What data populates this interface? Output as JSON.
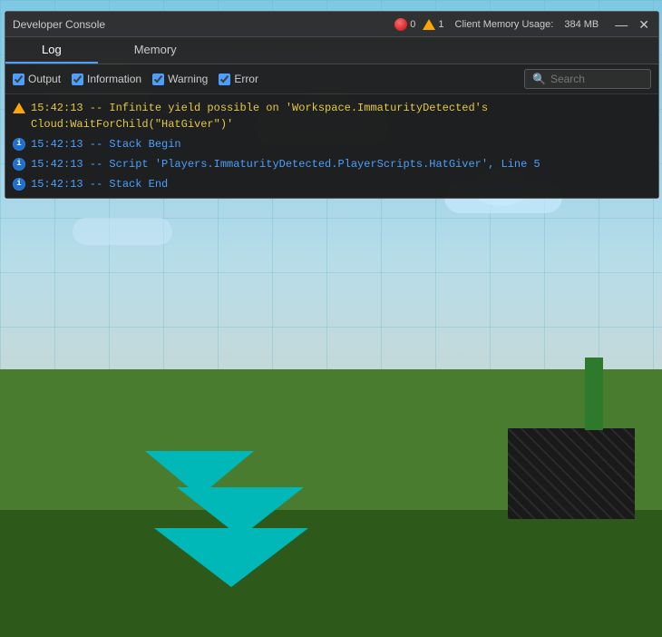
{
  "titleBar": {
    "title": "Developer Console",
    "errorCount": "0",
    "warningCount": "1",
    "memoryLabel": "Client Memory Usage:",
    "memoryValue": "384 MB",
    "minimizeBtn": "—",
    "closeBtn": "✕"
  },
  "tabs": [
    {
      "id": "log",
      "label": "Log",
      "active": true
    },
    {
      "id": "memory",
      "label": "Memory",
      "active": false
    }
  ],
  "filterBar": {
    "output": {
      "label": "Output",
      "checked": true
    },
    "information": {
      "label": "Information",
      "checked": true
    },
    "warning": {
      "label": "Warning",
      "checked": true
    },
    "error": {
      "label": "Error",
      "checked": true
    },
    "search": {
      "placeholder": "Search",
      "value": ""
    }
  },
  "logLines": [
    {
      "type": "warning",
      "text": "15:42:13 -- Infinite yield possible on 'Workspace.ImmaturityDetected's Cloud:WaitForChild(\"HatGiver\")'",
      "iconType": "warning"
    },
    {
      "type": "info",
      "text": "15:42:13 -- Stack Begin",
      "iconType": "info"
    },
    {
      "type": "info",
      "text": "15:42:13 -- Script 'Players.ImmaturityDetected.PlayerScripts.HatGiver', Line 5",
      "iconType": "info"
    },
    {
      "type": "info",
      "text": "15:42:13 -- Stack End",
      "iconType": "info"
    }
  ]
}
